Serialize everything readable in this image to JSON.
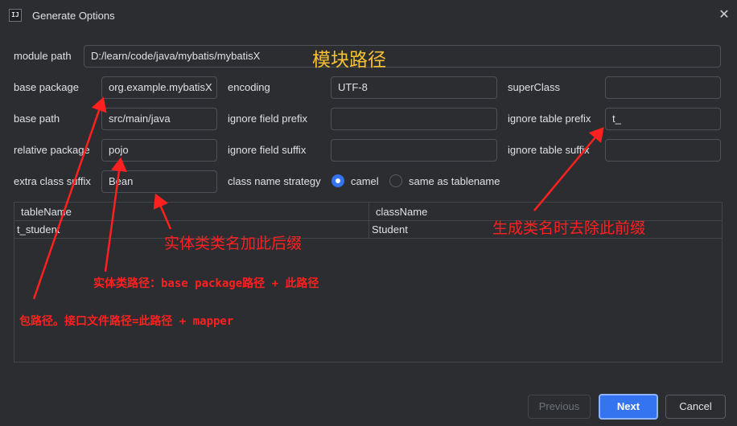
{
  "window": {
    "title": "Generate Options",
    "icon_text": "IJ"
  },
  "fields": {
    "module_path": {
      "label": "module path",
      "value": "D:/learn/code/java/mybatis/mybatisX"
    },
    "base_package": {
      "label": "base package",
      "value": "org.example.mybatisX"
    },
    "encoding": {
      "label": "encoding",
      "value": "UTF-8"
    },
    "super_class": {
      "label": "superClass",
      "value": ""
    },
    "base_path": {
      "label": "base path",
      "value": "src/main/java"
    },
    "ignore_field_prefix": {
      "label": "ignore field prefix",
      "value": ""
    },
    "ignore_table_prefix": {
      "label": "ignore table prefix",
      "value": "t_"
    },
    "relative_package": {
      "label": "relative package",
      "value": "pojo"
    },
    "ignore_field_suffix": {
      "label": "ignore field suffix",
      "value": ""
    },
    "ignore_table_suffix": {
      "label": "ignore table suffix",
      "value": ""
    },
    "extra_class_suffix": {
      "label": "extra class suffix",
      "value": "Bean"
    },
    "class_name_strategy": {
      "label": "class name strategy",
      "options": [
        "camel",
        "same as tablename"
      ],
      "selected": "camel"
    }
  },
  "table": {
    "headers": [
      "tableName",
      "className"
    ],
    "rows": [
      [
        "t_student",
        "Student"
      ]
    ]
  },
  "buttons": {
    "previous": "Previous",
    "next": "Next",
    "cancel": "Cancel"
  },
  "annotations": {
    "module": "模块路径",
    "suffix": "实体类类名加此后缀",
    "prefix": "生成类名时去除此前缀",
    "entity_path": "实体类路径：base package路径 + 此路径",
    "package_path": "包路径。接口文件路径=此路径 + mapper"
  },
  "colors": {
    "background": "#2b2d30",
    "accent": "#3574f0",
    "annotation_red": "#ff2020",
    "annotation_yellow": "#f5c033"
  }
}
